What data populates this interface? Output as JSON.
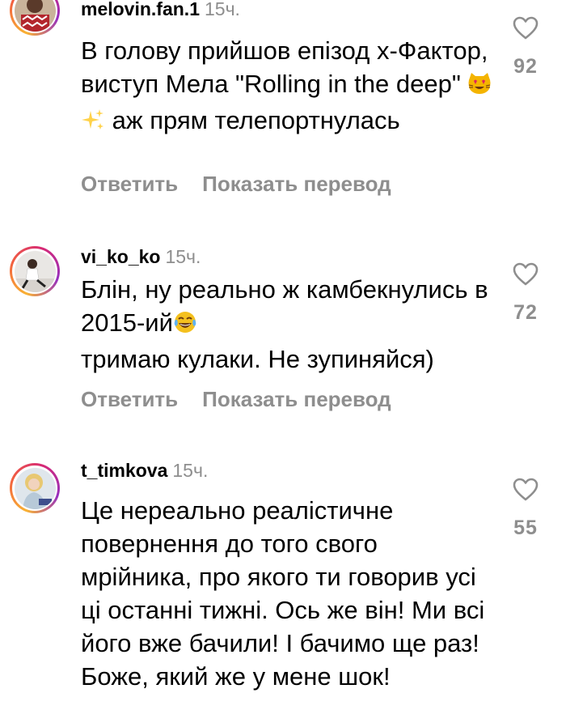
{
  "comments": [
    {
      "username": "melovin.fan.1",
      "time": "15ч.",
      "text_parts": [
        "В голову прийшов епізод х-Фактор, виступ Мела \"Rolling in the deep\" ",
        " аж прям телепортнулась"
      ],
      "emojis": [
        "heart-eyes-cat-emoji",
        "sparkles-emoji"
      ],
      "reply_label": "Ответить",
      "translate_label": "Показать перевод",
      "likes": "92",
      "avatar": "melovin-fan-avatar"
    },
    {
      "username": "vi_ko_ko",
      "time": "15ч.",
      "text_parts": [
        "Блін, ну реально ж камбекнулись в 2015-ий",
        " тримаю кулаки. Не зупиняйся)"
      ],
      "emojis": [
        "tears-of-joy-emoji"
      ],
      "reply_label": "Ответить",
      "translate_label": "Показать перевод",
      "likes": "72",
      "avatar": "vi-ko-ko-avatar"
    },
    {
      "username": "t_timkova",
      "time": "15ч.",
      "text": "Це нереально реалістичне повернення до того свого мрійника, про якого ти говорив усі ці останні тижні. Ось же він! Ми всі його вже бачили! І бачимо ще раз! Боже, який же у мене шок!",
      "likes": "55",
      "avatar": "t-timkova-avatar"
    }
  ],
  "colors": {
    "secondary_text": "#8e8e8e",
    "primary_text": "#000000",
    "story_ring": [
      "#f9b233",
      "#f2613f",
      "#d62976",
      "#962fbf"
    ]
  },
  "icons": {
    "like": "heart-outline-icon"
  }
}
